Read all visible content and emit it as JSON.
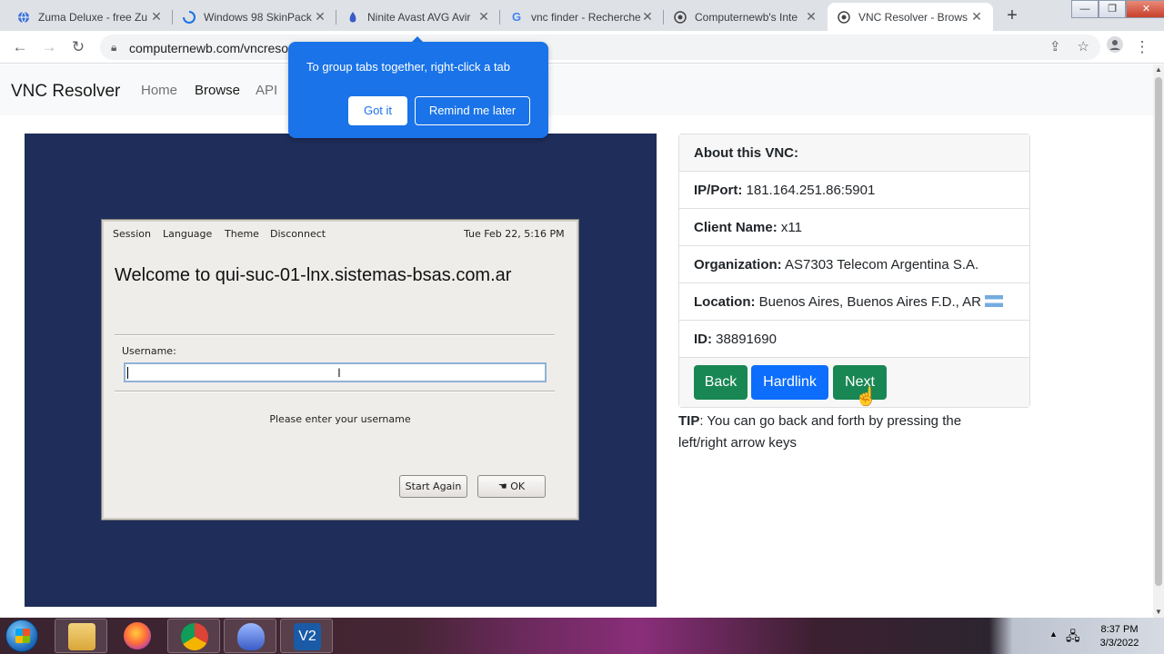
{
  "tabs": [
    {
      "title": "Zuma Deluxe - free Zu",
      "icon": "globe-icon"
    },
    {
      "title": "Windows 98 SkinPack",
      "icon": "loading-spinner-icon"
    },
    {
      "title": "Ninite Avast AVG Avir",
      "icon": "ninite-icon"
    },
    {
      "title": "vnc finder - Recherche",
      "icon": "google-icon"
    },
    {
      "title": "Computernewb's Inte",
      "icon": "computernewb-icon"
    },
    {
      "title": "VNC Resolver - Brows",
      "icon": "computernewb-icon"
    }
  ],
  "omnibox": {
    "url": "computernewb.com/vncreso"
  },
  "navbar": {
    "brand": "VNC Resolver",
    "links": [
      {
        "label": "Home"
      },
      {
        "label": "Browse",
        "active": true
      },
      {
        "label": "API"
      }
    ]
  },
  "tooltip": {
    "text": "To group tabs together, right-click a tab",
    "got_it": "Got it",
    "remind": "Remind me later"
  },
  "vnc_screen": {
    "menu": [
      "Session",
      "Language",
      "Theme",
      "Disconnect"
    ],
    "datetime": "Tue Feb 22,  5:16 PM",
    "welcome": "Welcome to qui-suc-01-lnx.sistemas-bsas.com.ar",
    "username_label": "Username:",
    "username_value": "",
    "message": "Please enter your username",
    "start_again": "Start Again",
    "ok": "OK"
  },
  "info": {
    "header": "About this VNC:",
    "rows": [
      {
        "label": "IP/Port:",
        "value": "181.164.251.86:5901"
      },
      {
        "label": "Client Name:",
        "value": "x11"
      },
      {
        "label": "Organization:",
        "value": "AS7303 Telecom Argentina S.A."
      },
      {
        "label": "Location:",
        "value": "Buenos Aires, Buenos Aires F.D., AR"
      },
      {
        "label": "ID:",
        "value": "38891690"
      }
    ],
    "buttons": {
      "back": "Back",
      "hardlink": "Hardlink",
      "next": "Next"
    }
  },
  "tip": {
    "label": "TIP",
    "text": ": You can go back and forth by pressing the left/right arrow keys"
  },
  "taskbar": {
    "time": "8:37 PM",
    "date": "3/3/2022"
  },
  "colors": {
    "green_button": "#198754",
    "blue_button": "#0d6efd",
    "tooltip_bg": "#1a73e8",
    "vnc_bg": "#1f2d5a"
  }
}
